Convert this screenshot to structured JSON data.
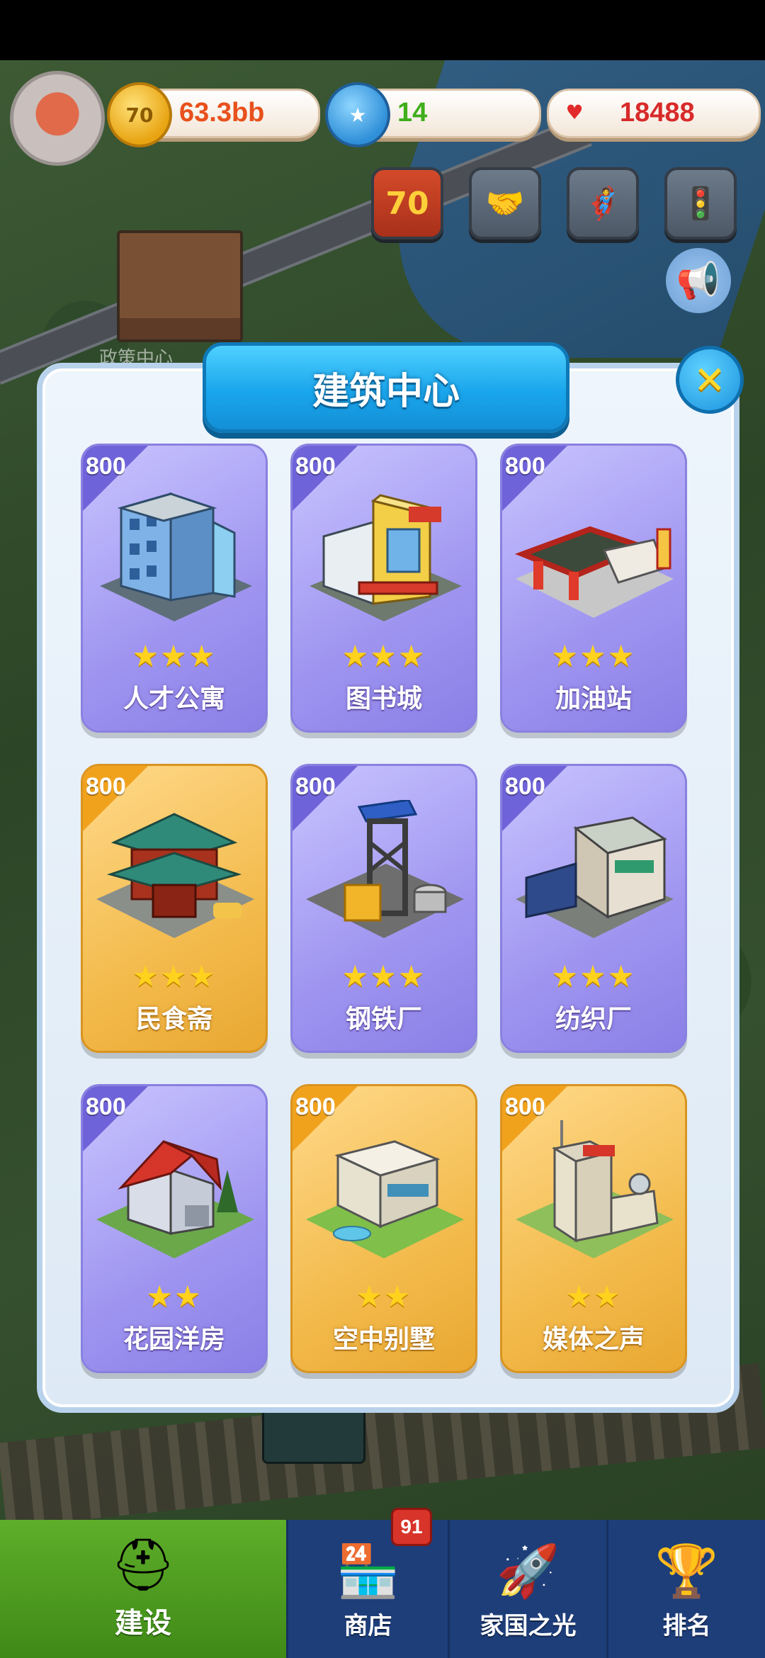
{
  "top_bar": {
    "coins": {
      "icon": "coin-icon",
      "icon_text": "70",
      "value": "63.3bb",
      "color": "#e8501c"
    },
    "stars": {
      "icon": "star-icon",
      "value": "14",
      "color": "#3fae1a"
    },
    "hearts": {
      "icon": "heart-icon",
      "value": "18488",
      "color": "#d82a2a"
    }
  },
  "map_label": "政策中心",
  "quick_icons": [
    {
      "name": "anniversary-70-icon",
      "text": "70"
    },
    {
      "name": "handshake-icon",
      "text": "🤝"
    },
    {
      "name": "hero-icon",
      "text": "🦸"
    },
    {
      "name": "traffic-light-icon",
      "text": "🚦"
    }
  ],
  "panel": {
    "title": "建筑中心",
    "close_icon": "close-icon",
    "cards": [
      {
        "price": "800",
        "stars": "★★★",
        "name": "人才公寓",
        "style": "purple"
      },
      {
        "price": "800",
        "stars": "★★★",
        "name": "图书城",
        "style": "purple"
      },
      {
        "price": "800",
        "stars": "★★★",
        "name": "加油站",
        "style": "purple"
      },
      {
        "price": "800",
        "stars": "★★★",
        "name": "民食斋",
        "style": "gold"
      },
      {
        "price": "800",
        "stars": "★★★",
        "name": "钢铁厂",
        "style": "purple"
      },
      {
        "price": "800",
        "stars": "★★★",
        "name": "纺织厂",
        "style": "purple"
      },
      {
        "price": "800",
        "stars": "★★",
        "name": "花园洋房",
        "style": "purple"
      },
      {
        "price": "800",
        "stars": "★★",
        "name": "空中别墅",
        "style": "gold"
      },
      {
        "price": "800",
        "stars": "★★",
        "name": "媒体之声",
        "style": "gold"
      }
    ]
  },
  "bottom_nav": {
    "items": [
      {
        "label": "建设",
        "icon": "hard-hat-icon",
        "active": true
      },
      {
        "label": "商店",
        "icon": "shop-icon",
        "badge": "91"
      },
      {
        "label": "家国之光",
        "icon": "rocket-icon"
      },
      {
        "label": "排名",
        "icon": "ranking-icon"
      }
    ]
  },
  "colors": {
    "accent_blue": "#1aa6ec",
    "nav_bg": "#1e3e7a",
    "nav_active": "#4f9c22",
    "card_purple": "#9f95f0",
    "card_gold": "#f3bb4d"
  }
}
